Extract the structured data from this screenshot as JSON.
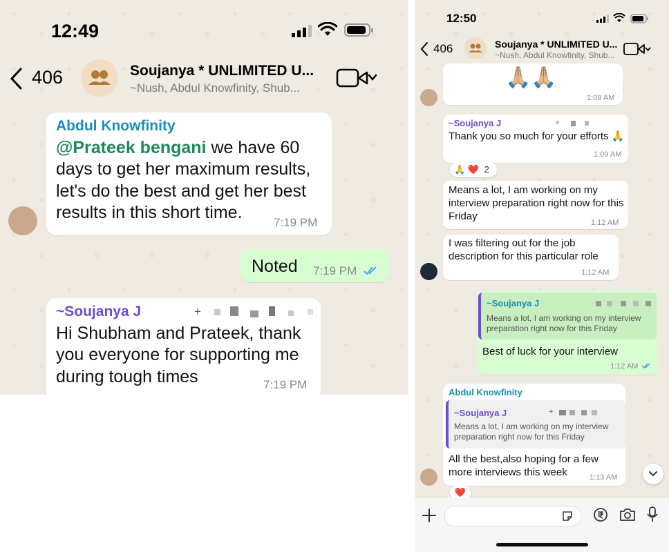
{
  "left": {
    "status_time": "12:49",
    "back_count": "406",
    "chat_title": "Soujanya * UNLIMITED U...",
    "chat_members": "~Nush, Abdul Knowfinity, Shub...",
    "messages": [
      {
        "sender": "Abdul Knowfinity",
        "mention": "@Prateek bengani",
        "text": " we have 60 days to get her maximum results, let's do the best and get her best results in this short time.",
        "time": "7:19 PM"
      },
      {
        "text": "Noted",
        "time": "7:19 PM"
      },
      {
        "sender": "~Soujanya J",
        "phone_prefix": "+",
        "text": "Hi Shubham and Prateek, thank you everyone for supporting me during tough times",
        "time": "7:19 PM"
      }
    ]
  },
  "right": {
    "status_time": "12:50",
    "back_count": "406",
    "chat_title": "Soujanya * UNLIMITED U...",
    "chat_members": "~Nush, Abdul Knowfinity, Shub...",
    "messages": [
      {
        "text": "🙏🏼🙏🏼",
        "time": "1:09 AM"
      },
      {
        "sender": "~Soujanya J",
        "text": "Thank you so much for your efforts 🙏",
        "time": "1:09 AM",
        "reaction": "🙏 ❤️",
        "reaction_count": "2"
      },
      {
        "text": "Means a lot, I am working on my interview preparation right now for this Friday",
        "time": "1:12 AM"
      },
      {
        "text": "I was filtering out for the job description for this particular role",
        "time": "1:12 AM"
      },
      {
        "quote_sender": "~Soujanya J",
        "quote_text": "Means a lot, I am working on my interview preparation right now for this Friday",
        "text": "Best of luck for your interview",
        "time": "1:12 AM"
      },
      {
        "sender": "Abdul Knowfinity",
        "quote_sender": "~Soujanya J",
        "quote_phone_prefix": "+",
        "quote_text": "Means a lot, I am working on my interview preparation right now for this Friday",
        "text": "All the best,also hoping for a few more interviews this week",
        "time": "1:13 AM",
        "reaction": "❤️"
      }
    ]
  },
  "colors": {
    "mention": "#1f8a5a",
    "sender_abdul": "#1b8fb5",
    "sender_soujanya": "#6b4fd0",
    "tick": "#4fa3e0",
    "outgoing": "#d9fdd3"
  }
}
